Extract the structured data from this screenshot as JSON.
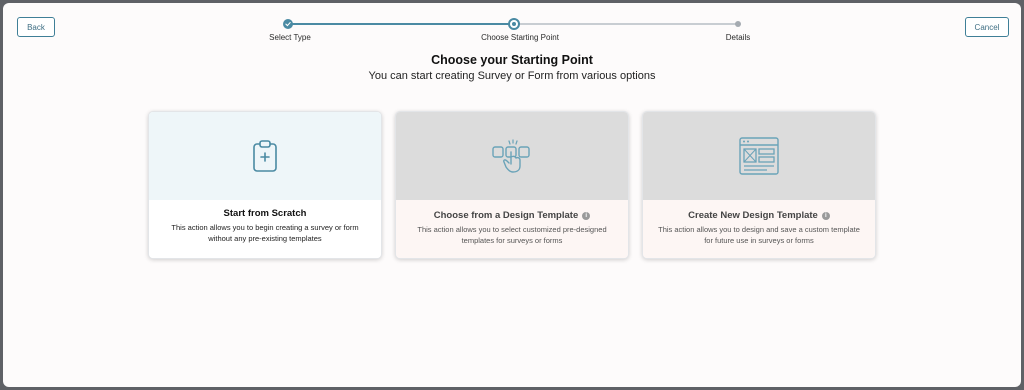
{
  "header": {
    "back_label": "Back",
    "cancel_label": "Cancel"
  },
  "stepper": {
    "steps": [
      {
        "label": "Select Type",
        "state": "completed"
      },
      {
        "label": "Choose Starting Point",
        "state": "current"
      },
      {
        "label": "Details",
        "state": "upcoming"
      }
    ]
  },
  "main": {
    "title": "Choose your Starting Point",
    "subtitle": "You can start creating Survey or Form from various options"
  },
  "cards": [
    {
      "icon": "clipboard-plus-icon",
      "title": "Start from Scratch",
      "description_line1": "This action allows you to begin creating a survey or form",
      "description_line2": "without any pre-existing templates",
      "enabled": true
    },
    {
      "icon": "hand-tap-template-icon",
      "title": "Choose from a Design Template",
      "description_line1": "This action allows you to select customized pre-designed",
      "description_line2": "templates for surveys or forms",
      "info_icon": "info-icon",
      "enabled": false
    },
    {
      "icon": "layout-template-icon",
      "title": "Create New Design Template",
      "description_line1": "This action allows you to design and save a custom template",
      "description_line2": "for future use in surveys or forms",
      "info_icon": "info-icon",
      "enabled": false
    }
  ],
  "colors": {
    "accent": "#4a8aa3",
    "card_active_top": "#eef6f9",
    "card_disabled_top": "#dcdcdc"
  }
}
